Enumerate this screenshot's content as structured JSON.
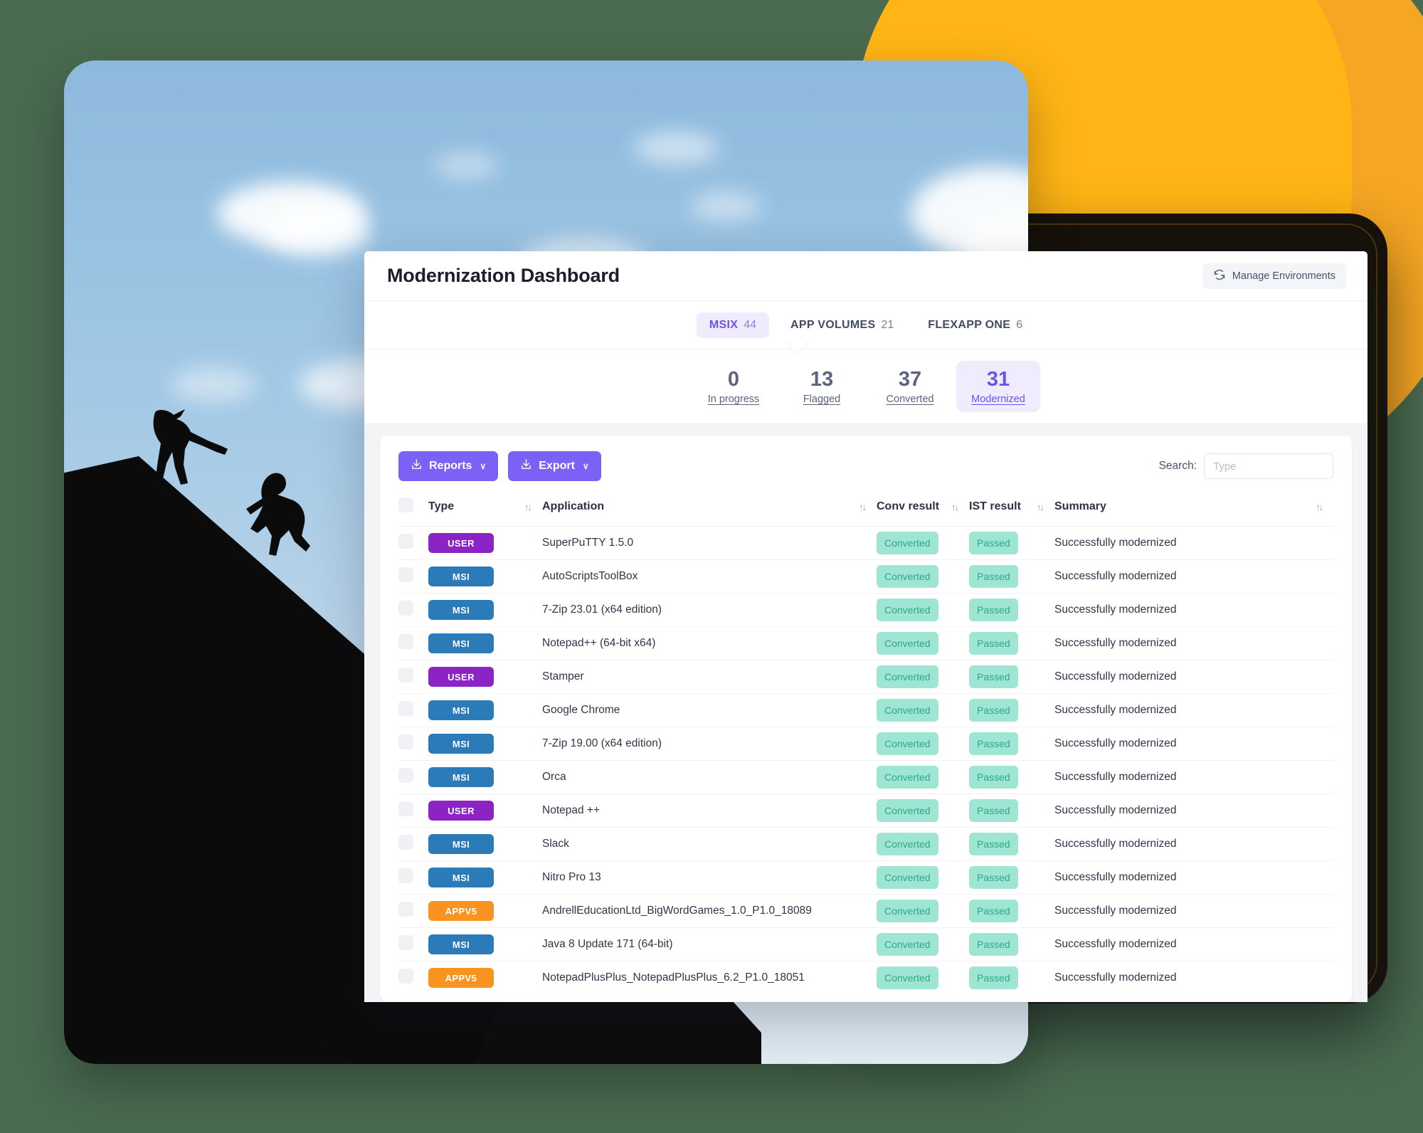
{
  "window": {
    "title": "Modernization Dashboard",
    "manage_environments_label": "Manage Environments"
  },
  "tabs": [
    {
      "label": "MSIX",
      "count": "44",
      "active": true
    },
    {
      "label": "APP VOLUMES",
      "count": "21",
      "active": false
    },
    {
      "label": "FLEXAPP ONE",
      "count": "6",
      "active": false
    }
  ],
  "stats": [
    {
      "value": "0",
      "label": "In progress",
      "active": false
    },
    {
      "value": "13",
      "label": "Flagged",
      "active": false
    },
    {
      "value": "37",
      "label": "Converted",
      "active": false
    },
    {
      "value": "31",
      "label": "Modernized",
      "active": true
    }
  ],
  "toolbar": {
    "reports_label": "Reports",
    "export_label": "Export",
    "chevron": "∨",
    "search_label": "Search:",
    "search_placeholder": "Type",
    "search_value": ""
  },
  "table": {
    "columns": [
      "Type",
      "Application",
      "Conv result",
      "IST result",
      "Summary"
    ],
    "sort_icon": "↑↓",
    "rows": [
      {
        "type": "USER",
        "application": "SuperPuTTY 1.5.0",
        "conv": "Converted",
        "ist": "Passed",
        "summary": "Successfully modernized"
      },
      {
        "type": "MSI",
        "application": "AutoScriptsToolBox",
        "conv": "Converted",
        "ist": "Passed",
        "summary": "Successfully modernized"
      },
      {
        "type": "MSI",
        "application": "7-Zip 23.01 (x64 edition)",
        "conv": "Converted",
        "ist": "Passed",
        "summary": "Successfully modernized"
      },
      {
        "type": "MSI",
        "application": "Notepad++ (64-bit x64)",
        "conv": "Converted",
        "ist": "Passed",
        "summary": "Successfully modernized"
      },
      {
        "type": "USER",
        "application": "Stamper",
        "conv": "Converted",
        "ist": "Passed",
        "summary": "Successfully modernized"
      },
      {
        "type": "MSI",
        "application": "Google Chrome",
        "conv": "Converted",
        "ist": "Passed",
        "summary": "Successfully modernized"
      },
      {
        "type": "MSI",
        "application": "7-Zip 19.00 (x64 edition)",
        "conv": "Converted",
        "ist": "Passed",
        "summary": "Successfully modernized"
      },
      {
        "type": "MSI",
        "application": "Orca",
        "conv": "Converted",
        "ist": "Passed",
        "summary": "Successfully modernized"
      },
      {
        "type": "USER",
        "application": "Notepad ++",
        "conv": "Converted",
        "ist": "Passed",
        "summary": "Successfully modernized"
      },
      {
        "type": "MSI",
        "application": "Slack",
        "conv": "Converted",
        "ist": "Passed",
        "summary": "Successfully modernized"
      },
      {
        "type": "MSI",
        "application": "Nitro Pro 13",
        "conv": "Converted",
        "ist": "Passed",
        "summary": "Successfully modernized"
      },
      {
        "type": "APPV5",
        "application": "AndrellEducationLtd_BigWordGames_1.0_P1.0_18089",
        "conv": "Converted",
        "ist": "Passed",
        "summary": "Successfully modernized"
      },
      {
        "type": "MSI",
        "application": "Java 8 Update 171 (64-bit)",
        "conv": "Converted",
        "ist": "Passed",
        "summary": "Successfully modernized"
      },
      {
        "type": "APPV5",
        "application": "NotepadPlusPlus_NotepadPlusPlus_6.2_P1.0_18051",
        "conv": "Converted",
        "ist": "Passed",
        "summary": "Successfully modernized"
      }
    ]
  },
  "colors": {
    "accent": "#7b61f5",
    "accent_soft": "#f0ecfe",
    "type_user": "#8c23c4",
    "type_msi": "#2a7bb8",
    "type_appv5": "#f7931e",
    "status_bg": "#9fe5d4",
    "status_text": "#2aa98a",
    "background_green": "#4a6b50",
    "blob_yellow": "#ffb515"
  }
}
